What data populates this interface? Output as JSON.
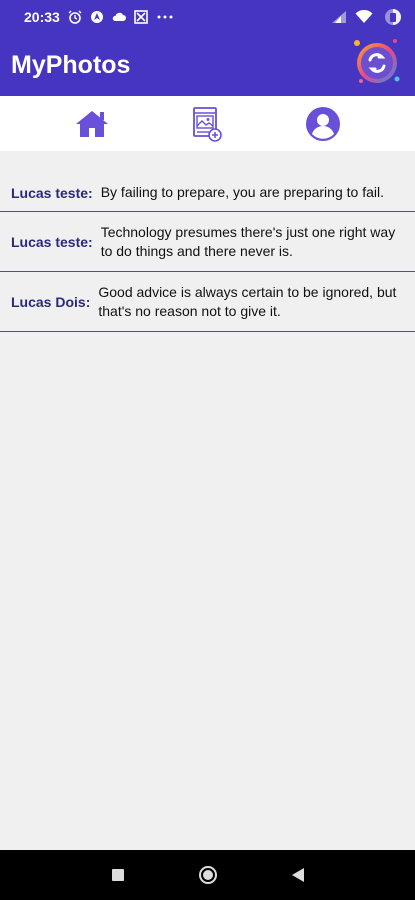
{
  "status_bar": {
    "time": "20:33",
    "left_icons": [
      "alarm-icon",
      "nav-arrow-icon",
      "cloud-icon",
      "app-icon",
      "more-icon"
    ],
    "right_icons": [
      "signal-icon",
      "wifi-icon",
      "battery-icon"
    ]
  },
  "app_bar": {
    "title": "MyPhotos",
    "logo": "app-logo-icon"
  },
  "tabs": [
    {
      "name": "home",
      "icon": "home-icon"
    },
    {
      "name": "add-photo",
      "icon": "add-image-icon"
    },
    {
      "name": "profile",
      "icon": "user-circle-icon"
    }
  ],
  "messages": [
    {
      "author": "Lucas teste:",
      "text": "By failing to prepare, you are preparing to fail."
    },
    {
      "author": "Lucas teste:",
      "text": "Technology presumes there's just one right way to do things and there never is."
    },
    {
      "author": "Lucas Dois:",
      "text": "Good advice is always certain to be ignored, but that's no reason not to give it."
    }
  ],
  "nav_bar": {
    "buttons": [
      "recent-apps-icon",
      "home-button-icon",
      "back-icon"
    ]
  },
  "colors": {
    "primary": "#4535c1",
    "accent": "#6a4fd8",
    "author": "#2b2a7a",
    "divider": "#4f47b8",
    "background": "#f0f0f0"
  }
}
